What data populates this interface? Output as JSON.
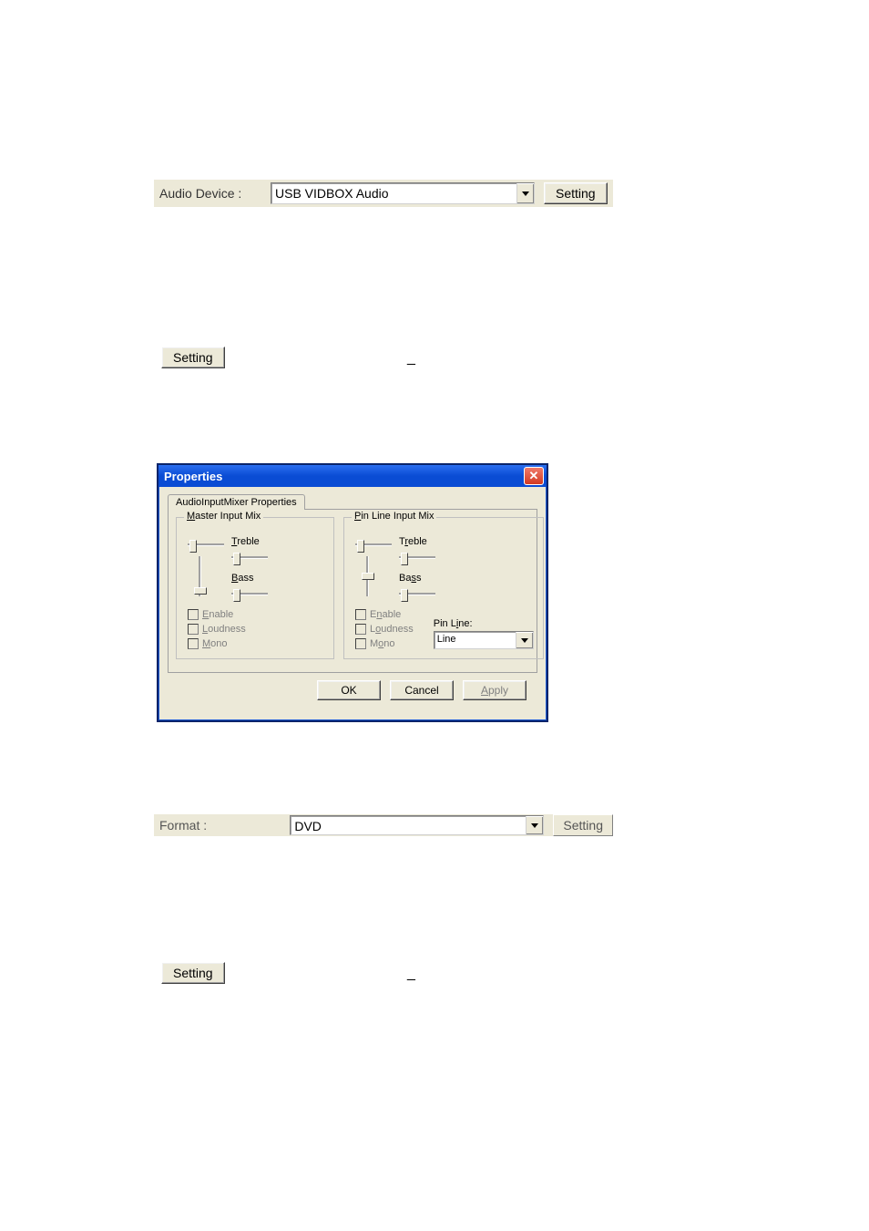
{
  "audio_bar": {
    "label": "Audio Device :",
    "value": "USB VIDBOX Audio",
    "setting_button": "Setting"
  },
  "standalone": {
    "setting_button_1": "Setting",
    "underscore_1": "_",
    "setting_button_2": "Setting",
    "underscore_2": "_"
  },
  "dialog": {
    "title": "Properties",
    "tab": "AudioInputMixer Properties",
    "master": {
      "legend_prefix": "M",
      "legend_rest": "aster Input Mix",
      "treble_prefix": "T",
      "treble_rest": "reble",
      "bass_prefix": "B",
      "bass_rest": "ass",
      "enable_prefix": "E",
      "enable_rest": "nable",
      "loudness_prefix": "L",
      "loudness_rest": "oudness",
      "mono_prefix": "M",
      "mono_rest": "ono"
    },
    "pinline": {
      "legend_prefix": "P",
      "legend_rest": "in Line Input Mix",
      "treble_prefix": "r",
      "treble_before": "T",
      "treble_rest": "eble",
      "bass_prefix": "s",
      "bass_before": "Ba",
      "bass_rest": "s",
      "enable_prefix": "n",
      "enable_before": "E",
      "enable_rest": "able",
      "loudness_prefix": "o",
      "loudness_before": "L",
      "loudness_rest": "udness",
      "mono_prefix": "o",
      "mono_before": "M",
      "mono_rest": "no",
      "pin_line_label_prefix": "i",
      "pin_line_label_before": "Pin L",
      "pin_line_label_rest": "ne:",
      "pin_line_value": "Line"
    },
    "buttons": {
      "ok": "OK",
      "cancel": "Cancel",
      "apply_prefix": "A",
      "apply_rest": "pply"
    }
  },
  "format_bar": {
    "label": "Format :",
    "value": "DVD",
    "setting_button": "Setting"
  }
}
